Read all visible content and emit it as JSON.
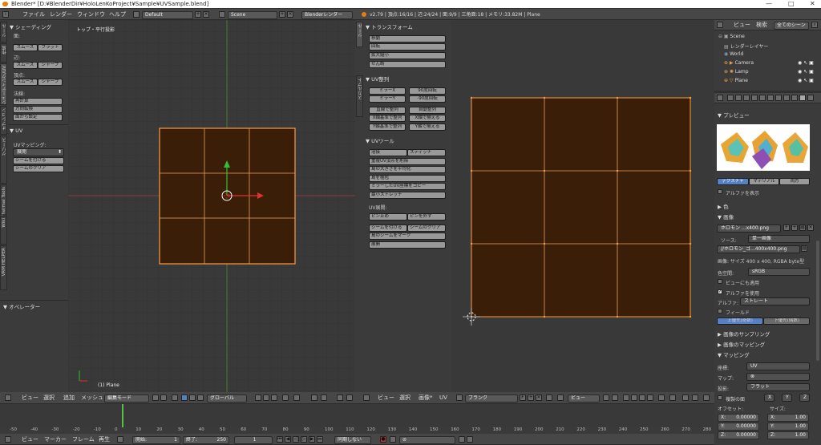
{
  "window": {
    "title": "Blender* [D:¥BlenderDir¥HoloLenKoProject¥Sample¥UVSample.blend]",
    "min": "—",
    "max": "□",
    "close": "✕"
  },
  "topbar": {
    "menus": [
      "ファイル",
      "レンダー",
      "ウィンドウ",
      "ヘルプ"
    ],
    "layout": "Default",
    "scene": "Scene",
    "engine": "Blenderレンダー",
    "stats": "v2.79 | 頂点:16/16 | 辺:24/24 | 面:9/9 | 三角面:18 | メモリ:33.82M | Plane"
  },
  "toolshelf": {
    "tabs": [
      "ツール",
      "作成",
      "シェーディング/UV",
      "オプション",
      "グリース",
      "Thermal Tools",
      "Wiki",
      "VRM HELPER"
    ],
    "shading_header": "▼ シェーディング",
    "face_label": "面:",
    "edge_label": "辺:",
    "vertex_label": "頂点:",
    "smooth": "スムーズ",
    "flat": "フラット",
    "sharp": "シャープ",
    "normals_label": "法線:",
    "recalc": "再計算",
    "flip": "方向転換",
    "from_face": "面から設定",
    "uv_header": "▼ UV",
    "uv_mapping": "UVマッピング:",
    "unwrap": "展開",
    "mark_seam": "シームを付ける",
    "clear_seam": "シームのクリア",
    "operator_header": "▼ オペレーター"
  },
  "viewport3d": {
    "view_name": "トップ・平行投影",
    "object_label": "(1) Plane",
    "menus": [
      "ビュー",
      "選択",
      "追加",
      "メッシュ"
    ],
    "mode": "編集モード",
    "orientation": "グローバル"
  },
  "uvtools": {
    "tabs": [
      "ツール",
      "スカルプト"
    ],
    "transform_header": "▼ トランスフォーム",
    "move": "移動",
    "rotate": "回転",
    "scale": "拡大縮小",
    "shear": "せん断",
    "uvalign_header": "▼ UV整列",
    "mirror_x": "ミラーX",
    "mirror_y": "ミラーY",
    "rot90": "90度回転",
    "rot_m90": "-90度回転",
    "straighten": "直線で整列",
    "auto_align": "自動整列",
    "align_x_base": "X軸基準で整列",
    "align_x": "X軸で揃える",
    "align_y_base": "Y軸基準で整列",
    "align_y": "Y軸で揃える",
    "uvtools_header": "▼ UVツール",
    "weld": "溶接",
    "stitch": "スティッチ",
    "remove_doubles": "重複UV頂点を削除",
    "average_scale": "島の大きさを平均化",
    "pack": "島を梱包",
    "copy_mirror": "ミラーしたUV座標をコピー",
    "minimize_stretch": "最小ストレッチ",
    "unwrap_label": "UV展開:",
    "pin": "ピン止め",
    "unpin": "ピンを外す",
    "mark_seam": "シームを付ける",
    "clear_seam": "シームのクリア",
    "seams_from_islands": "島のシームをマーク",
    "unwrap": "展開"
  },
  "uveditor": {
    "menus": [
      "ビュー",
      "選択",
      "画像*",
      "UV"
    ],
    "image": "ブランク",
    "view_menu": "ビュー"
  },
  "outliner": {
    "menus": [
      "ビュー",
      "検索"
    ],
    "filter": "全てのシーン",
    "items": [
      {
        "name": "Scene"
      },
      {
        "name": "レンダーレイヤー"
      },
      {
        "name": "World"
      },
      {
        "name": "Camera"
      },
      {
        "name": "Lamp"
      },
      {
        "name": "Plane"
      }
    ]
  },
  "properties": {
    "preview_header": "▼ プレビュー",
    "tabs": [
      "テクスチャ",
      "マテリアル",
      "両方"
    ],
    "alpha_show": "アルファを表示",
    "color_header": "▶ 色",
    "image_header": "▼ 画像",
    "image_name": "ホロモン ...x400.png",
    "source_label": "ソース:",
    "source": "単一画像",
    "file": "//ホロモン_ゴ...400x400.png",
    "image_info": "画像: サイズ 400 x 400,  RGBA byte型",
    "colorspace_label": "色空間:",
    "colorspace": "sRGB",
    "view_as_render": "ビューにも適用",
    "use_alpha": "アルファを使用",
    "alpha_label": "アルファ:",
    "alpha_mode": "ストレート",
    "fields": "フィールド",
    "upper_first": "上優先(奇数)",
    "lower_first": "下優先(偶数)",
    "sampling_header": "▶ 画像のサンプリング",
    "mapping_img_header": "▶ 画像のマッピング",
    "mapping_header": "▼ マッピング",
    "coords_label": "座標:",
    "coords": "UV",
    "map_label": "マップ:",
    "projection_label": "投影:",
    "projection": "フラット",
    "offset_label": "オフセット:",
    "size_label": "サイズ:",
    "offset": [
      "0.00000",
      "0.00000",
      "0.00000"
    ],
    "size": [
      "1.00",
      "1.00",
      "1.00"
    ],
    "axis": [
      "X:",
      "Y:",
      "Z:"
    ],
    "x_sel": "X",
    "y_sel": "Y",
    "z_sel": "Z",
    "tex_label": "複製の面"
  },
  "timeline": {
    "ticks": [
      "-50",
      "-40",
      "-30",
      "-20",
      "-10",
      "0",
      "10",
      "20",
      "30",
      "40",
      "50",
      "60",
      "70",
      "80",
      "90",
      "100",
      "110",
      "120",
      "130",
      "140",
      "150",
      "160",
      "170",
      "180",
      "190",
      "200",
      "210",
      "220",
      "230",
      "240",
      "250",
      "260",
      "270",
      "280"
    ],
    "menus": [
      "ビュー",
      "マーカー",
      "フレーム",
      "再生"
    ],
    "start_label": "開始:",
    "start": "1",
    "end_label": "終了:",
    "end": "250",
    "current": "1",
    "sync": "同期しない"
  },
  "colors": {
    "face": "#3a1e07",
    "edge": "#ff9d3b",
    "grid": "#2f2f2f"
  }
}
